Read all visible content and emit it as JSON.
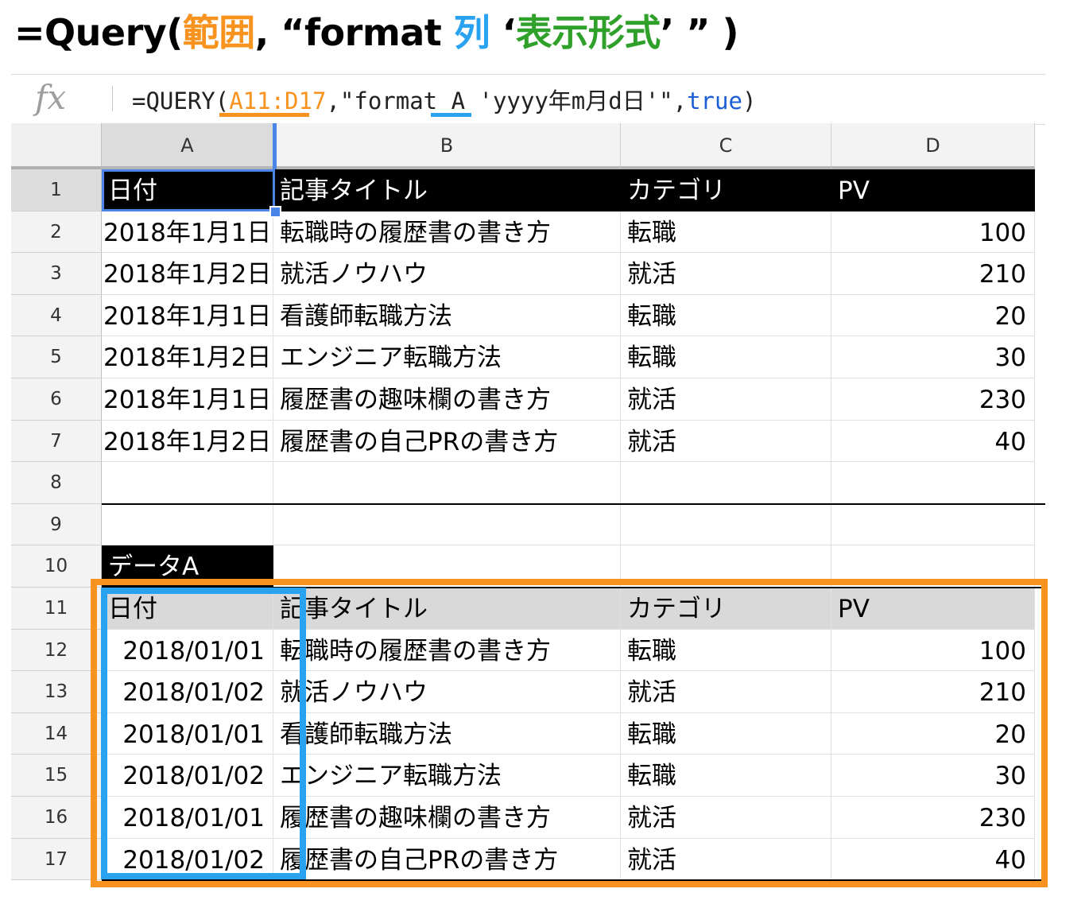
{
  "headline": {
    "prefix": "=Query(",
    "range_word": "範囲",
    "comma_open": ", “format ",
    "col_word": "列",
    "quote_open": " ‘",
    "format_word": "表示形式",
    "suffix": "’ ” )"
  },
  "formula_bar": {
    "icon": "fx",
    "part1": "=QUERY(",
    "range": "A11:D17",
    "part2": ",\"format A 'yyyy年m月d日'\",",
    "bool": "true",
    "part3": ")"
  },
  "columns": [
    "A",
    "B",
    "C",
    "D"
  ],
  "rows": [
    {
      "num": "1",
      "style": "dark",
      "cells": [
        "日付",
        "記事タイトル",
        "カテゴリ",
        "PV"
      ]
    },
    {
      "num": "2",
      "cells": [
        "2018年1月1日",
        "転職時の履歴書の書き方",
        "転職",
        "100"
      ]
    },
    {
      "num": "3",
      "cells": [
        "2018年1月2日",
        "就活ノウハウ",
        "就活",
        "210"
      ]
    },
    {
      "num": "4",
      "cells": [
        "2018年1月1日",
        "看護師転職方法",
        "転職",
        "20"
      ]
    },
    {
      "num": "5",
      "cells": [
        "2018年1月2日",
        "エンジニア転職方法",
        "転職",
        "30"
      ]
    },
    {
      "num": "6",
      "cells": [
        "2018年1月1日",
        "履歴書の趣味欄の書き方",
        "就活",
        "230"
      ]
    },
    {
      "num": "7",
      "cells": [
        "2018年1月2日",
        "履歴書の自己PRの書き方",
        "就活",
        "40"
      ]
    },
    {
      "num": "8",
      "cells": [
        "",
        "",
        "",
        ""
      ]
    },
    {
      "num": "9",
      "cells": [
        "",
        "",
        "",
        ""
      ]
    },
    {
      "num": "10",
      "style": "label",
      "cells": [
        "データA",
        "",
        "",
        ""
      ]
    },
    {
      "num": "11",
      "style": "gray",
      "cells": [
        "日付",
        "記事タイトル",
        "カテゴリ",
        "PV"
      ]
    },
    {
      "num": "12",
      "style": "result",
      "cells": [
        "2018/01/01",
        "転職時の履歴書の書き方",
        "転職",
        "100"
      ]
    },
    {
      "num": "13",
      "style": "result",
      "cells": [
        "2018/01/02",
        "就活ノウハウ",
        "就活",
        "210"
      ]
    },
    {
      "num": "14",
      "style": "result",
      "cells": [
        "2018/01/01",
        "看護師転職方法",
        "転職",
        "20"
      ]
    },
    {
      "num": "15",
      "style": "result",
      "cells": [
        "2018/01/02",
        "エンジニア転職方法",
        "転職",
        "30"
      ]
    },
    {
      "num": "16",
      "style": "result",
      "cells": [
        "2018/01/01",
        "履歴書の趣味欄の書き方",
        "就活",
        "230"
      ]
    },
    {
      "num": "17",
      "style": "result",
      "cells": [
        "2018/01/02",
        "履歴書の自己PRの書き方",
        "就活",
        "40"
      ]
    }
  ],
  "colors": {
    "range_orange": "#f7931e",
    "column_blue": "#29a3f0",
    "format_green": "#2fa12b",
    "selection_blue": "#4a86e8"
  }
}
